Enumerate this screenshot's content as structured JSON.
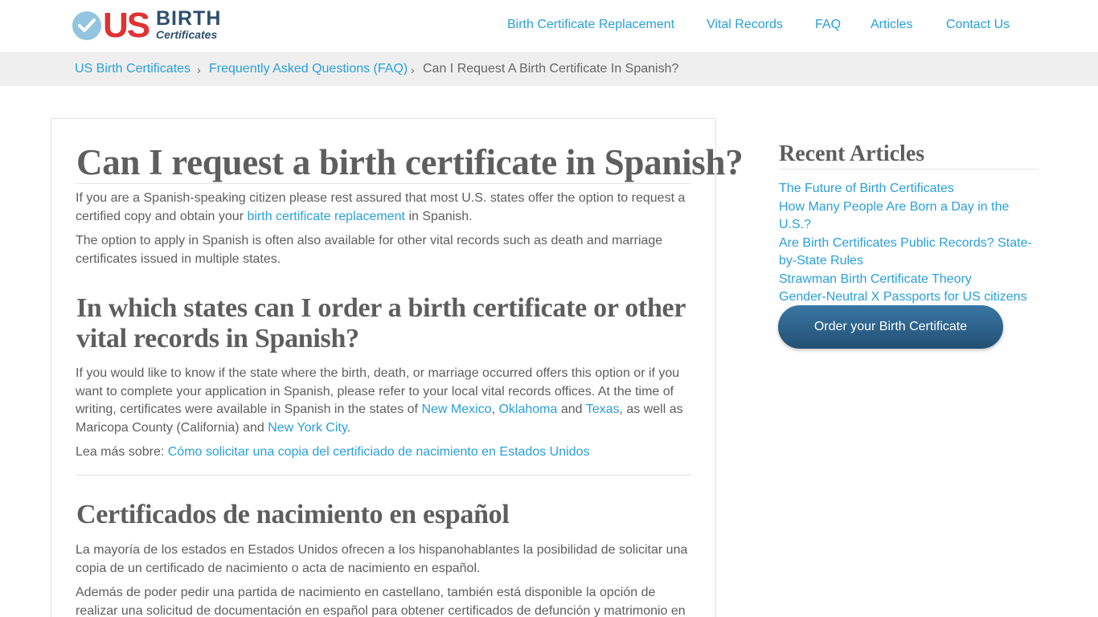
{
  "logo": {
    "us": "US",
    "birth": "BIRTH",
    "certificates": "Certificates"
  },
  "nav": {
    "items": [
      "Birth Certificate Replacement",
      "Vital Records",
      "FAQ",
      "Articles",
      "Contact Us"
    ]
  },
  "breadcrumb": {
    "home": "US Birth Certificates",
    "sep": "›",
    "faq": "Frequently Asked Questions (FAQ)",
    "current": "Can I Request A Birth Certificate In Spanish?"
  },
  "article": {
    "title": "Can I request a birth certificate in Spanish?",
    "p1_a": "If you are a Spanish-speaking citizen please rest assured that most U.S. states offer the option to request a certified copy and obtain your ",
    "p1_link": "birth certificate replacement",
    "p1_b": " in Spanish.",
    "p2": "The option to apply in Spanish is often also available for other vital records such as death and marriage certificates issued in multiple states.",
    "h2_1": "In which states can I order a birth certificate or other vital records in Spanish?",
    "p3_a": "If you would like to know if the state where the birth, death, or marriage occurred offers this option or if you want to complete your application in Spanish, please refer to your local vital records offices. At the time of writing, certificates were available in Spanish in the states of ",
    "p3_link1": "New Mexico",
    "p3_comma": ", ",
    "p3_link2": "Oklahoma",
    "p3_and": " and ",
    "p3_link3": "Texas",
    "p3_b": ", as well as Maricopa County (California) and ",
    "p3_link4": "New York City",
    "p3_end": ".",
    "p4_a": "Lea más sobre: ",
    "p4_link": "Cómo solicitar una copia del certificiado de nacimiento en Estados Unidos",
    "h2_2": "Certificados de nacimiento en español",
    "p5": "La mayoría de los estados en Estados Unidos ofrecen a los hispanohablantes la posibilidad de solicitar una copia de un certificado de nacimiento o acta de nacimiento en español.",
    "p6": "Además de poder pedir una partida de nacimiento en castellano, también está disponible la opción de realizar una solicitud de documentación en español para obtener certificados de defunción y matrimonio en"
  },
  "sidebar": {
    "title": "Recent Articles",
    "articles": [
      "The Future of Birth Certificates",
      "How Many People Are Born a Day in the U.S.?",
      "Are Birth Certificates Public Records? State-by-State Rules",
      "Strawman Birth Certificate Theory",
      "Gender-Neutral X Passports for US citizens"
    ],
    "button": "Order your Birth Certificate"
  },
  "colors": {
    "accent": "#2a9fd8",
    "logo_red": "#e03232",
    "logo_navy": "#2f4f6c",
    "button": "#2d6590"
  }
}
